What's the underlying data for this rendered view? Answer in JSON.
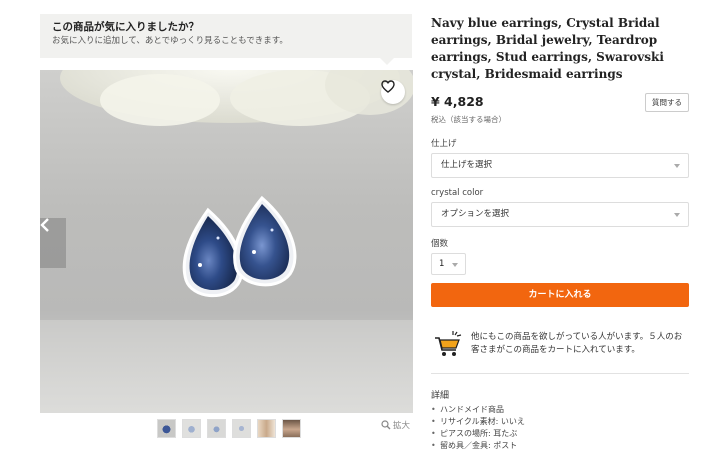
{
  "favorite_prompt": {
    "title": "この商品が気に入りましたか？",
    "subtitle": "お気に入りに追加して、あとでゆっくり見ることもできます。"
  },
  "gallery": {
    "favorite_icon": "heart-icon",
    "prev_icon": "chevron-left-icon",
    "next_icon": "chevron-right-icon",
    "thumbnail_count": 6,
    "zoom_label": "拡大"
  },
  "product": {
    "title": "Navy blue earrings, Crystal Bridal earrings, Bridal jewelry, Teardrop earrings, Stud earrings, Swarovski crystal, Bridesmaid earrings",
    "price": "¥ 4,828",
    "ask_button": "質問する",
    "tax_note": "税込（該当する場合）"
  },
  "options": {
    "finish_label": "仕上げ",
    "finish_value": "仕上げを選択",
    "crystal_label": "crystal color",
    "crystal_value": "オプションを選択",
    "quantity_label": "個数",
    "quantity_value": "1"
  },
  "cart": {
    "add_button": "カートに入れる",
    "notice": "他にもこの商品を欲しがっている人がいます。５人のお客さまがこの商品をカートに入れています。"
  },
  "details": {
    "title": "詳細",
    "items": [
      "ハンドメイド商品",
      "リサイクル素材: いいえ",
      "ピアスの場所: 耳たぶ",
      "留め具／金具: ポスト"
    ]
  },
  "colors": {
    "accent": "#f2660f",
    "banner_bg": "#f1f1ef"
  }
}
